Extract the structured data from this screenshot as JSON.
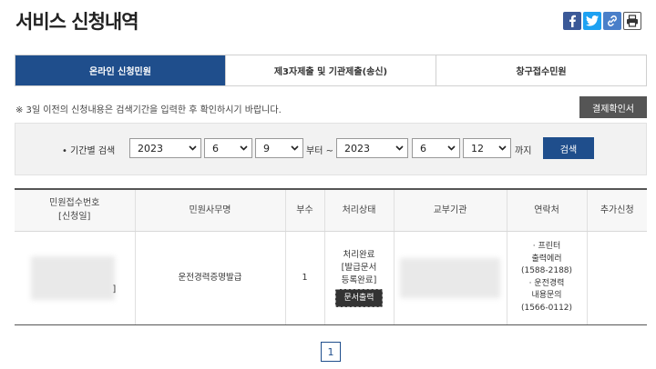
{
  "header": {
    "title": "서비스 신청내역"
  },
  "share": {
    "icons": [
      "facebook-icon",
      "twitter-icon",
      "link-icon",
      "print-icon"
    ],
    "colors": {
      "facebook": "#3b5998",
      "twitter": "#1da1f2"
    }
  },
  "tabs": [
    {
      "label": "온라인 신청민원",
      "active": true
    },
    {
      "label": "제3자제출 및 기관제출(송신)",
      "active": false
    },
    {
      "label": "창구접수민원",
      "active": false
    }
  ],
  "notice": "※ 3일 이전의 신청내용은 검색기간을 입력한 후 확인하시기 바랍니다.",
  "receipt_button": "결제확인서",
  "search": {
    "label": "• 기간별 검색",
    "from": {
      "year": "2023",
      "month": "6",
      "day": "9"
    },
    "between": "부터 ~",
    "to": {
      "year": "2023",
      "month": "6",
      "day": "12"
    },
    "until": "까지",
    "button": "검색"
  },
  "table": {
    "headers": [
      "민원접수번호\n[신청일]",
      "민원사무명",
      "부수",
      "처리상태",
      "교부기관",
      "연락처",
      "추가신청"
    ],
    "row": {
      "receipt_suffix": "]",
      "service_name": "운전경력증명발급",
      "copies": "1",
      "status": "처리완료\n[발급문서\n등록완료]",
      "status_button": "문서출력",
      "contact": "· 프린터\n출력에러\n(1588-2188)\n· 운전경력\n내용문의\n(1566-0112)"
    }
  },
  "pager": {
    "current": "1"
  },
  "accent_color": "#1f4e8c"
}
